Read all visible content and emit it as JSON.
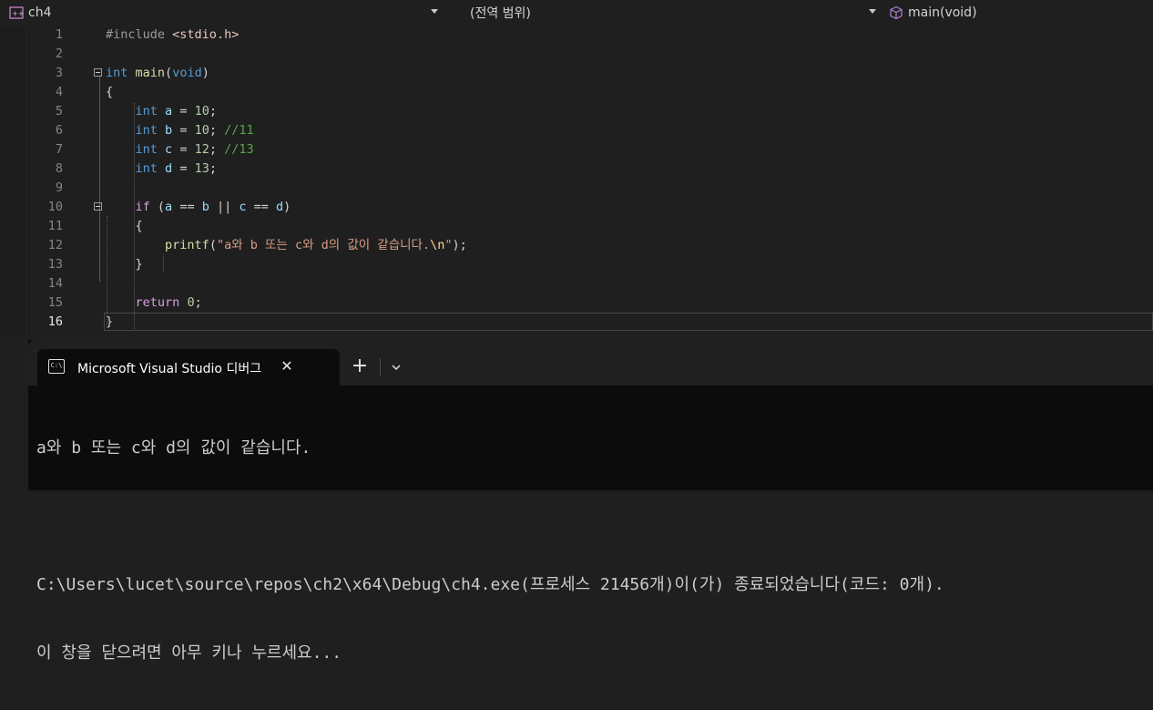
{
  "navbar": {
    "project": "ch4",
    "scope": "(전역 범위)",
    "member": "main(void)"
  },
  "editor": {
    "line_numbers": [
      "1",
      "2",
      "3",
      "4",
      "5",
      "6",
      "7",
      "8",
      "9",
      "10",
      "11",
      "12",
      "13",
      "14",
      "15",
      "16"
    ],
    "active_line": "16"
  },
  "terminal": {
    "tab_title": "Microsoft Visual Studio 디버그",
    "tab_icon_text": "C:\\",
    "new_tab_symbol": "+",
    "close_symbol": "✕",
    "output": [
      "a와 b 또는 c와 d의 값이 같습니다.",
      "",
      "C:\\Users\\lucet\\source\\repos\\ch2\\x64\\Debug\\ch4.exe(프로세스 21456개)이(가) 종료되었습니다(코드: 0개).",
      "이 창을 닫으려면 아무 키나 누르세요..."
    ]
  }
}
